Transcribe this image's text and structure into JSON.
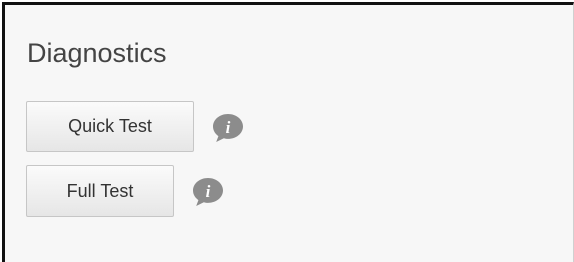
{
  "section": {
    "title": "Diagnostics"
  },
  "buttons": {
    "quick_test": "Quick Test",
    "full_test": "Full Test"
  },
  "icons": {
    "quick_test_info": "info-speech-bubble-icon",
    "full_test_info": "info-speech-bubble-icon",
    "info_glyph": "i"
  },
  "colors": {
    "panel_background": "#f7f7f7",
    "title_text": "#444444",
    "icon_fill": "#8c8c8c",
    "button_border": "#c6c6c6"
  }
}
